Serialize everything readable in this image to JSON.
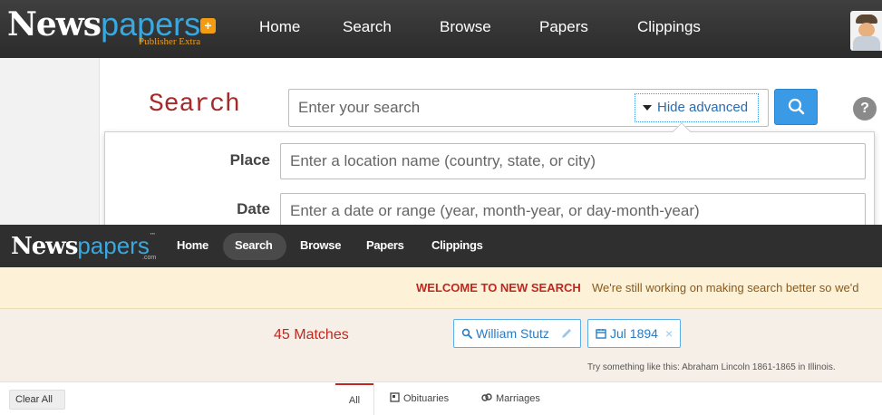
{
  "top": {
    "logo": {
      "news": "N",
      "wordmark_rest": "ews",
      "papers": "papers",
      "badge": "+",
      "subtitle": "Publisher Extra"
    },
    "nav": [
      {
        "label": "Home"
      },
      {
        "label": "Search"
      },
      {
        "label": "Browse"
      },
      {
        "label": "Papers"
      },
      {
        "label": "Clippings"
      }
    ],
    "search_title": "Search",
    "search_placeholder": "Enter your search",
    "hide_advanced_label": "Hide advanced",
    "help_label": "?",
    "advanced": {
      "place_label": "Place",
      "place_placeholder": "Enter a location name (country, state, or city)",
      "date_label": "Date",
      "date_placeholder": "Enter a date or range (year, month-year, or day-month-year)"
    },
    "icons": {
      "search": "search-icon",
      "help": "help-icon",
      "avatar": "avatar-icon",
      "caret": "caret-down-icon"
    },
    "colors": {
      "accent_blue": "#3a9ae6",
      "title_red": "#a52a2a",
      "badge_orange": "#f39c12"
    }
  },
  "bottom": {
    "logo": {
      "news": "N",
      "wordmark_rest": "ews",
      "papers": "papers",
      "tm": "™",
      "com": ".com"
    },
    "nav": [
      {
        "label": "Home"
      },
      {
        "label": "Search"
      },
      {
        "label": "Browse"
      },
      {
        "label": "Papers"
      },
      {
        "label": "Clippings"
      }
    ],
    "welcome": {
      "lead": "WELCOME TO NEW SEARCH",
      "rest": "We're still working on making search better so we'd"
    },
    "matches": "45 Matches",
    "chips": [
      {
        "label": "William Stutz",
        "icon": "search-icon",
        "action_icon": "pencil-icon"
      },
      {
        "label": "Jul 1894",
        "icon": "calendar-icon",
        "action": "×"
      }
    ],
    "try_text": "Try something like this: Abraham Lincoln 1861-1865 in Illinois.",
    "clear_all": "Clear All",
    "tabs": [
      {
        "label": "All",
        "active": true
      },
      {
        "label": "Obituaries",
        "icon": "obituary-icon"
      },
      {
        "label": "Marriages",
        "icon": "rings-icon"
      }
    ],
    "colors": {
      "welcome_bg": "#fdf1d7",
      "matches_red": "#c0281f",
      "chip_blue": "#2a7cc2"
    }
  }
}
